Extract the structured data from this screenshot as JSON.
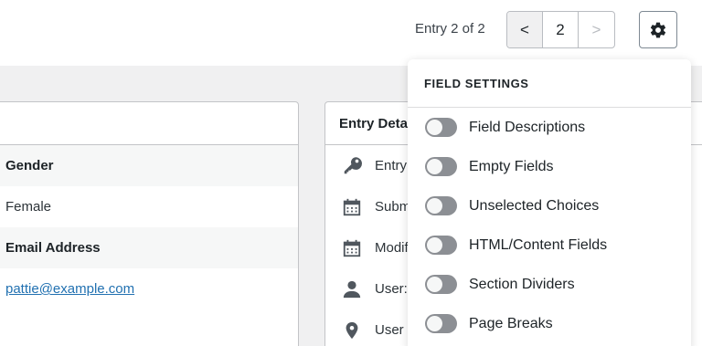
{
  "header": {
    "entry_count": "Entry 2 of 2",
    "pager": {
      "prev": "<",
      "current": "2",
      "next": ">"
    }
  },
  "fields": [
    {
      "label": "Gender",
      "value": "Female",
      "is_link": false
    },
    {
      "label": "Email Address",
      "value": "pattie@example.com",
      "is_link": true
    }
  ],
  "entry_details": {
    "title": "Entry Details",
    "rows": [
      {
        "icon": "key-icon",
        "text": "Entry"
      },
      {
        "icon": "calendar-icon",
        "text": "Submitted"
      },
      {
        "icon": "calendar-icon",
        "text": "Modified"
      },
      {
        "icon": "user-icon",
        "text": "User:"
      },
      {
        "icon": "location-pin-icon",
        "text": "User"
      }
    ]
  },
  "field_settings": {
    "title": "FIELD SETTINGS",
    "toggles": [
      {
        "label": "Field Descriptions",
        "on": false
      },
      {
        "label": "Empty Fields",
        "on": false
      },
      {
        "label": "Unselected Choices",
        "on": false
      },
      {
        "label": "HTML/Content Fields",
        "on": false
      },
      {
        "label": "Section Dividers",
        "on": false
      },
      {
        "label": "Page Breaks",
        "on": false
      }
    ]
  },
  "colors": {
    "link": "#2271b1",
    "toggle_off": "#8c8f94",
    "page_bg": "#f0f0f1"
  }
}
